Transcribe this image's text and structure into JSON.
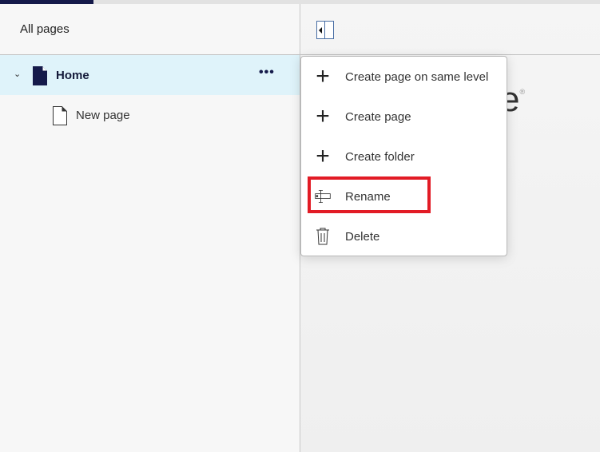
{
  "sidebar": {
    "title": "All pages",
    "tree": [
      {
        "label": "Home",
        "icon": "page-filled-icon",
        "expanded": true,
        "selected": true,
        "more": "•••"
      },
      {
        "label": "New page",
        "icon": "page-outline-icon"
      }
    ]
  },
  "main": {
    "logo_fragment": "e",
    "logo_mark": "®"
  },
  "context_menu": {
    "items": [
      {
        "label": "Create page on same level",
        "icon": "plus-icon"
      },
      {
        "label": "Create page",
        "icon": "plus-icon"
      },
      {
        "label": "Create folder",
        "icon": "plus-icon"
      },
      {
        "label": "Rename",
        "icon": "rename-icon",
        "highlighted": true
      },
      {
        "label": "Delete",
        "icon": "trash-icon"
      }
    ]
  },
  "colors": {
    "accent": "#151a4a",
    "selected_row": "#dff3fa",
    "highlight": "#e21b25"
  }
}
